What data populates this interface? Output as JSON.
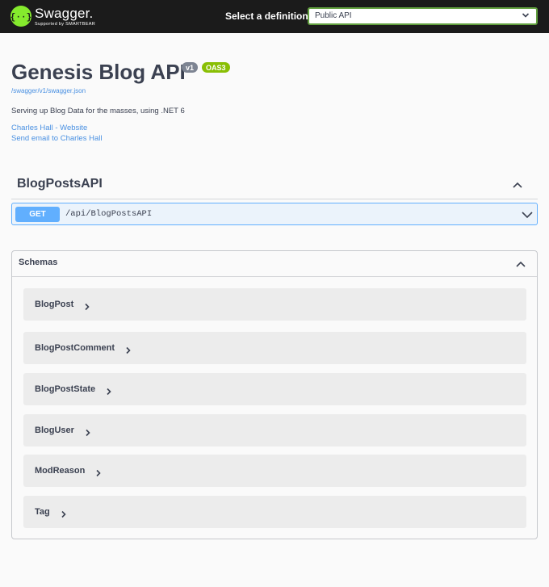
{
  "topbar": {
    "brand": "Swagger.",
    "brand_sub": "Supported by SMARTBEAR",
    "definition_label": "Select a definition",
    "definition_selected": "Public API"
  },
  "info": {
    "title": "Genesis Blog API",
    "version_badge": "v1",
    "oas_badge": "OAS3",
    "spec_url": "/swagger/v1/swagger.json",
    "description": "Serving up Blog Data for the masses, using .NET 6",
    "contact_website": "Charles Hall - Website",
    "contact_email": "Send email to Charles Hall"
  },
  "tag": {
    "name": "BlogPostsAPI",
    "operations": [
      {
        "method": "GET",
        "path": "/api/BlogPostsAPI"
      }
    ]
  },
  "schemas": {
    "title": "Schemas",
    "models": [
      "BlogPost",
      "BlogPostComment",
      "BlogPostState",
      "BlogUser",
      "ModReason",
      "Tag"
    ]
  },
  "colors": {
    "topbar_bg": "#1b1b1b",
    "brand_green": "#85ea2d",
    "get_blue": "#61affe",
    "link_blue": "#4990e2",
    "oas_green": "#89bf04"
  }
}
